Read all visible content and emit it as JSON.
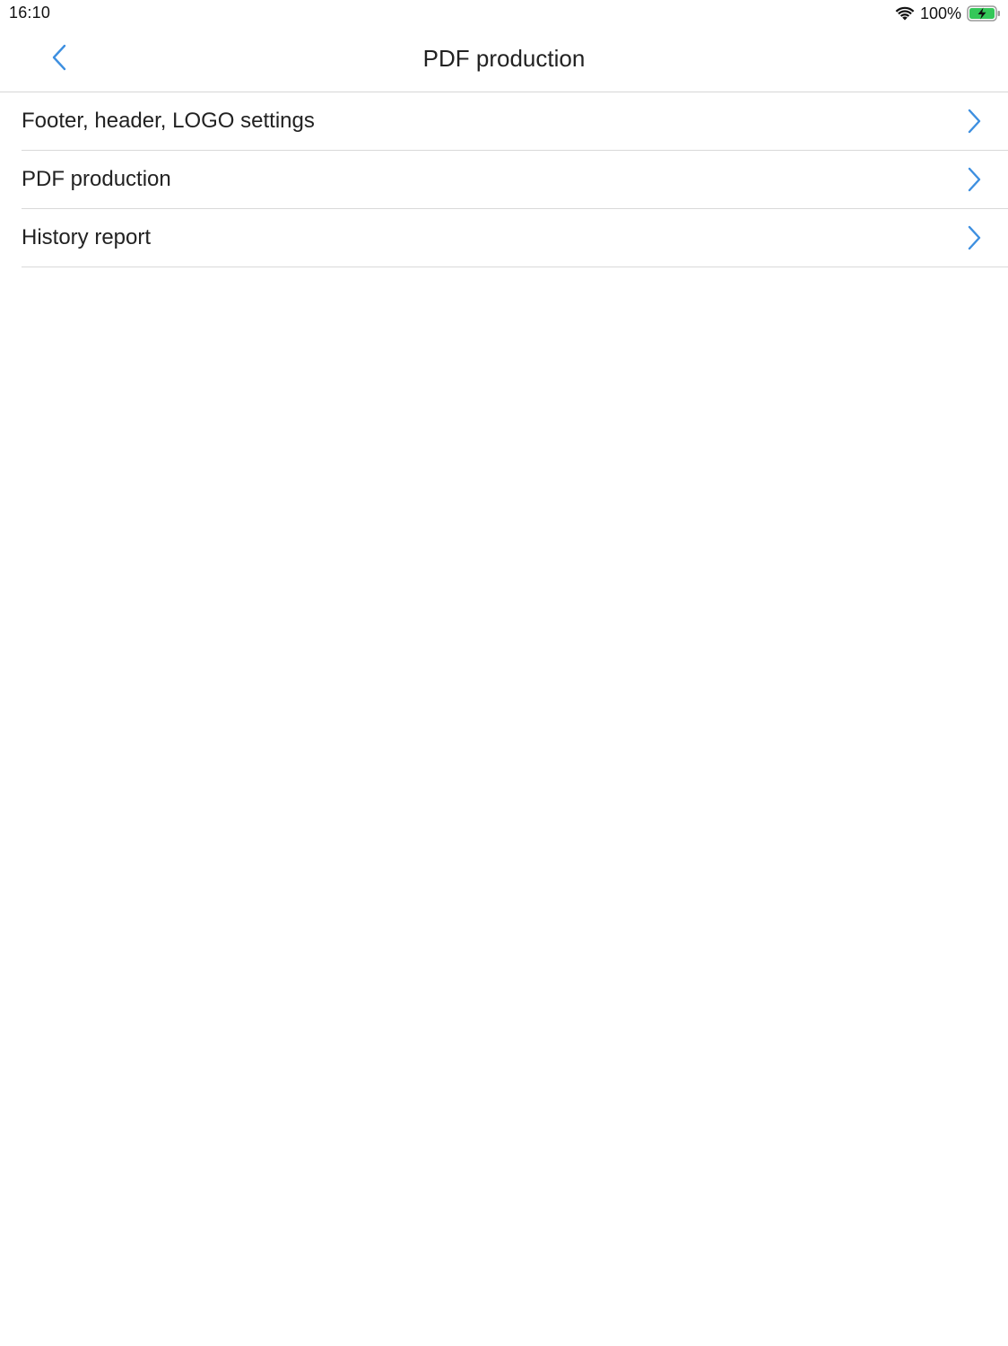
{
  "status_bar": {
    "time": "16:10",
    "battery_percent": "100%",
    "battery_level": 1.0,
    "wifi_icon": "wifi-icon",
    "battery_icon": "battery-charging-icon",
    "battery_color": "#34c759"
  },
  "nav": {
    "title": "PDF production",
    "back_icon": "chevron-left-icon",
    "accent_color": "#3d8fe0"
  },
  "menu": {
    "items": [
      {
        "label": "Footer, header, LOGO settings",
        "icon": "chevron-right-icon"
      },
      {
        "label": "PDF production",
        "icon": "chevron-right-icon"
      },
      {
        "label": "History report",
        "icon": "chevron-right-icon"
      }
    ]
  }
}
